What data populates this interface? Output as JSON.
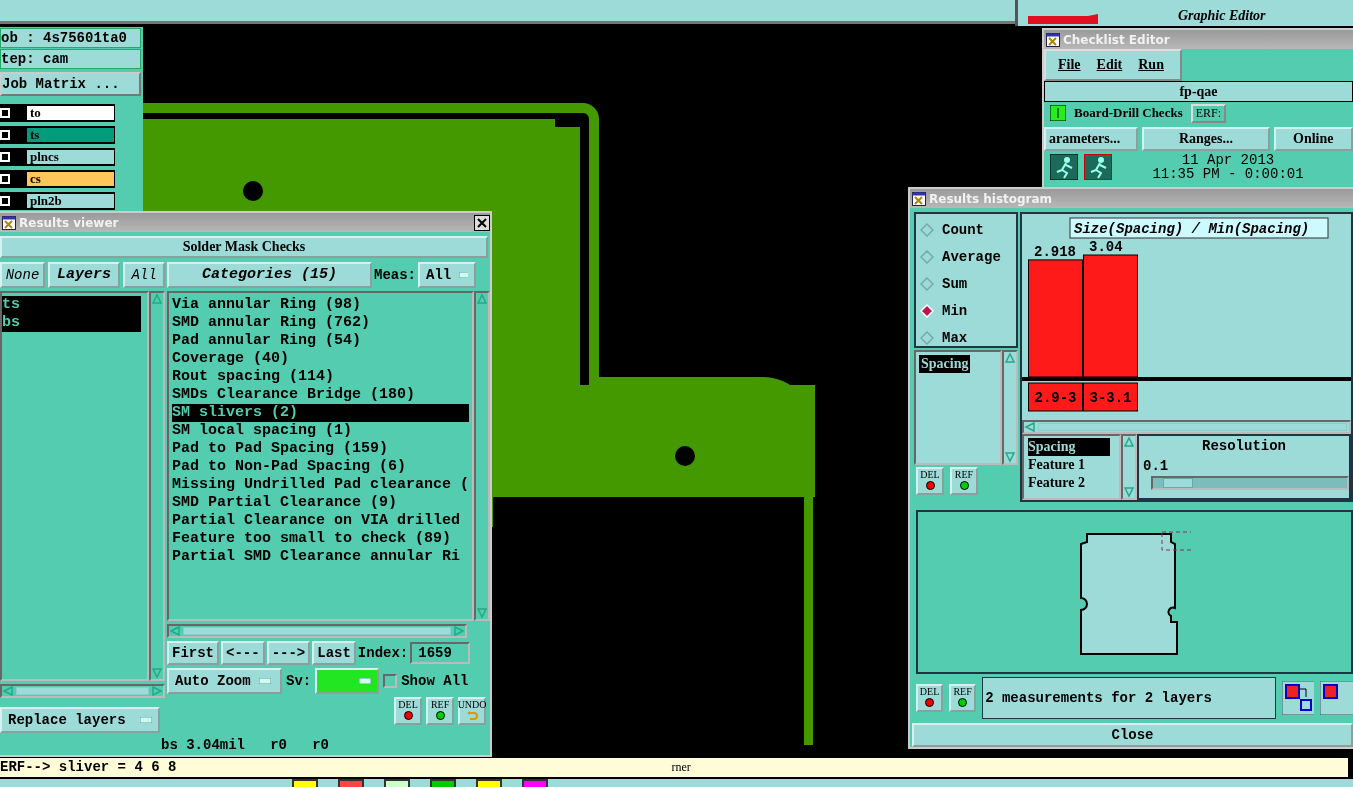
{
  "app": {
    "job": "ob : 4s75601ta0",
    "step": "tep: cam",
    "job_matrix": "Job Matrix ...",
    "layers": [
      {
        "name": "to",
        "color": "#ffffff",
        "checked": false
      },
      {
        "name": "ts",
        "color": "#009c7c",
        "checked": false
      },
      {
        "name": "plncs",
        "color": "#9ddbd9",
        "checked": false
      },
      {
        "name": "cs",
        "color": "#ffc65a",
        "checked": false
      },
      {
        "name": "pln2b",
        "color": "#9ddbd9",
        "checked": false
      }
    ],
    "subtitle": "Graphic Editor",
    "message": "rner"
  },
  "checklist_editor": {
    "title": "Checklist Editor",
    "menu": [
      "File",
      "Edit",
      "Run"
    ],
    "checklist": "fp-qae",
    "check_name": "Board-Drill Checks",
    "erf_label": "ERF:",
    "buttons": [
      "arameters...",
      "Ranges...",
      "Online"
    ],
    "date": "11 Apr 2013",
    "time": "11:35 PM - 0:00:01"
  },
  "results_viewer": {
    "title": "Results viewer",
    "heading": "Solder Mask Checks",
    "none_button": "None",
    "layers_label": "Layers",
    "all_button": "All",
    "categories_title": "Categories (15)",
    "meas_label": "Meas:",
    "meas_value": "All",
    "layers": [
      {
        "name": "ts",
        "selected": true
      },
      {
        "name": "bs",
        "selected": true
      }
    ],
    "categories": [
      {
        "label": "Via annular Ring (98)",
        "selected": false
      },
      {
        "label": "SMD annular Ring (762)",
        "selected": false
      },
      {
        "label": "Pad annular Ring (54)",
        "selected": false
      },
      {
        "label": "Coverage (40)",
        "selected": false
      },
      {
        "label": "Rout spacing (114)",
        "selected": false
      },
      {
        "label": "SMDs Clearance Bridge (180)",
        "selected": false
      },
      {
        "label": "SM slivers (2)",
        "selected": true
      },
      {
        "label": "SM local spacing (1)",
        "selected": false
      },
      {
        "label": "Pad to Pad Spacing (159)",
        "selected": false
      },
      {
        "label": "Pad to Non-Pad Spacing (6)",
        "selected": false
      },
      {
        "label": "Missing Undrilled Pad clearance (",
        "selected": false
      },
      {
        "label": "SMD Partial Clearance (9)",
        "selected": false
      },
      {
        "label": "Partial Clearance on VIA drilled",
        "selected": false
      },
      {
        "label": "Feature too small to check (89)",
        "selected": false
      },
      {
        "label": "Partial SMD Clearance annular Ri",
        "selected": false
      }
    ],
    "nav": [
      "First",
      "<---",
      "--->",
      "Last"
    ],
    "index_label": "Index:",
    "index_value": "1659",
    "zoom_mode": "Auto Zoom",
    "sv_label": "Sv:",
    "show_all": {
      "label": "Show All",
      "checked": false
    },
    "replace_mode": "Replace layers",
    "actions": [
      "DEL",
      "REF",
      "UNDO"
    ],
    "status": "bs 3.04mil   r0   r0",
    "erf_line": "ERF--> sliver = 4 6 8"
  },
  "results_histogram": {
    "title": "Results histogram",
    "modes": [
      {
        "label": "Count",
        "selected": false
      },
      {
        "label": "Average",
        "selected": false
      },
      {
        "label": "Sum",
        "selected": false
      },
      {
        "label": "Min",
        "selected": true
      },
      {
        "label": "Max",
        "selected": false
      }
    ],
    "attributes": [
      {
        "label": "Spacing",
        "selected": true
      }
    ],
    "chart_data": {
      "type": "bar",
      "title": "Size(Spacing) / Min(Spacing)",
      "categories": [
        "2.9-3",
        "3-3.1"
      ],
      "values": [
        2.918,
        3.04
      ],
      "data_labels": true
    },
    "fields": [
      {
        "label": "Spacing",
        "selected": true
      },
      {
        "label": "Feature 1",
        "selected": false
      },
      {
        "label": "Feature 2",
        "selected": false
      }
    ],
    "resolution_label": "Resolution",
    "resolution_value": "0.1",
    "resolution_slider": {
      "level": 0.05
    },
    "actions": [
      "DEL",
      "REF"
    ],
    "bottom_actions": [
      "DEL",
      "REF"
    ],
    "summary": "2 measurements for 2 layers",
    "close": "Close"
  }
}
